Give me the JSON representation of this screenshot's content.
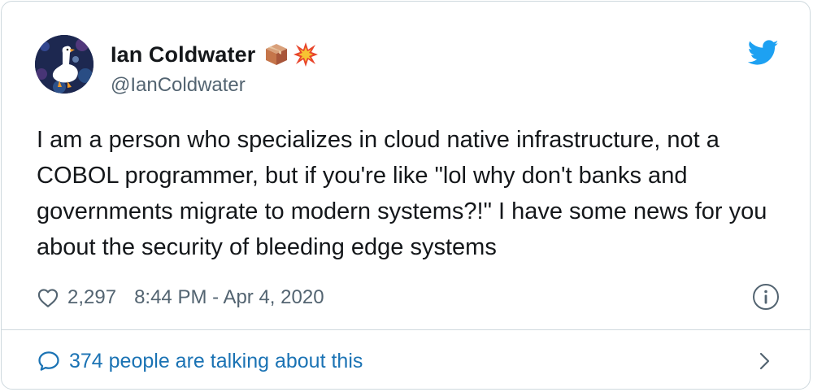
{
  "author": {
    "display_name": "Ian Coldwater",
    "handle": "@IanColdwater",
    "badge_icons": [
      "package-icon",
      "collision-icon"
    ]
  },
  "tweet": {
    "text": "I am a person who specializes in cloud native infrastructure, not a COBOL programmer, but if you're like \"lol why don't banks and governments migrate to modern systems?!\" I have some news for you about the security of bleeding edge systems"
  },
  "meta": {
    "like_count": "2,297",
    "timestamp": "8:44 PM - Apr 4, 2020"
  },
  "footer": {
    "conversation_label": "374 people are talking about this"
  },
  "colors": {
    "twitter_blue": "#1da1f2",
    "link_blue": "#1b73b4",
    "text_primary": "#14171a",
    "text_secondary": "#536471",
    "border": "#cfd9de"
  }
}
